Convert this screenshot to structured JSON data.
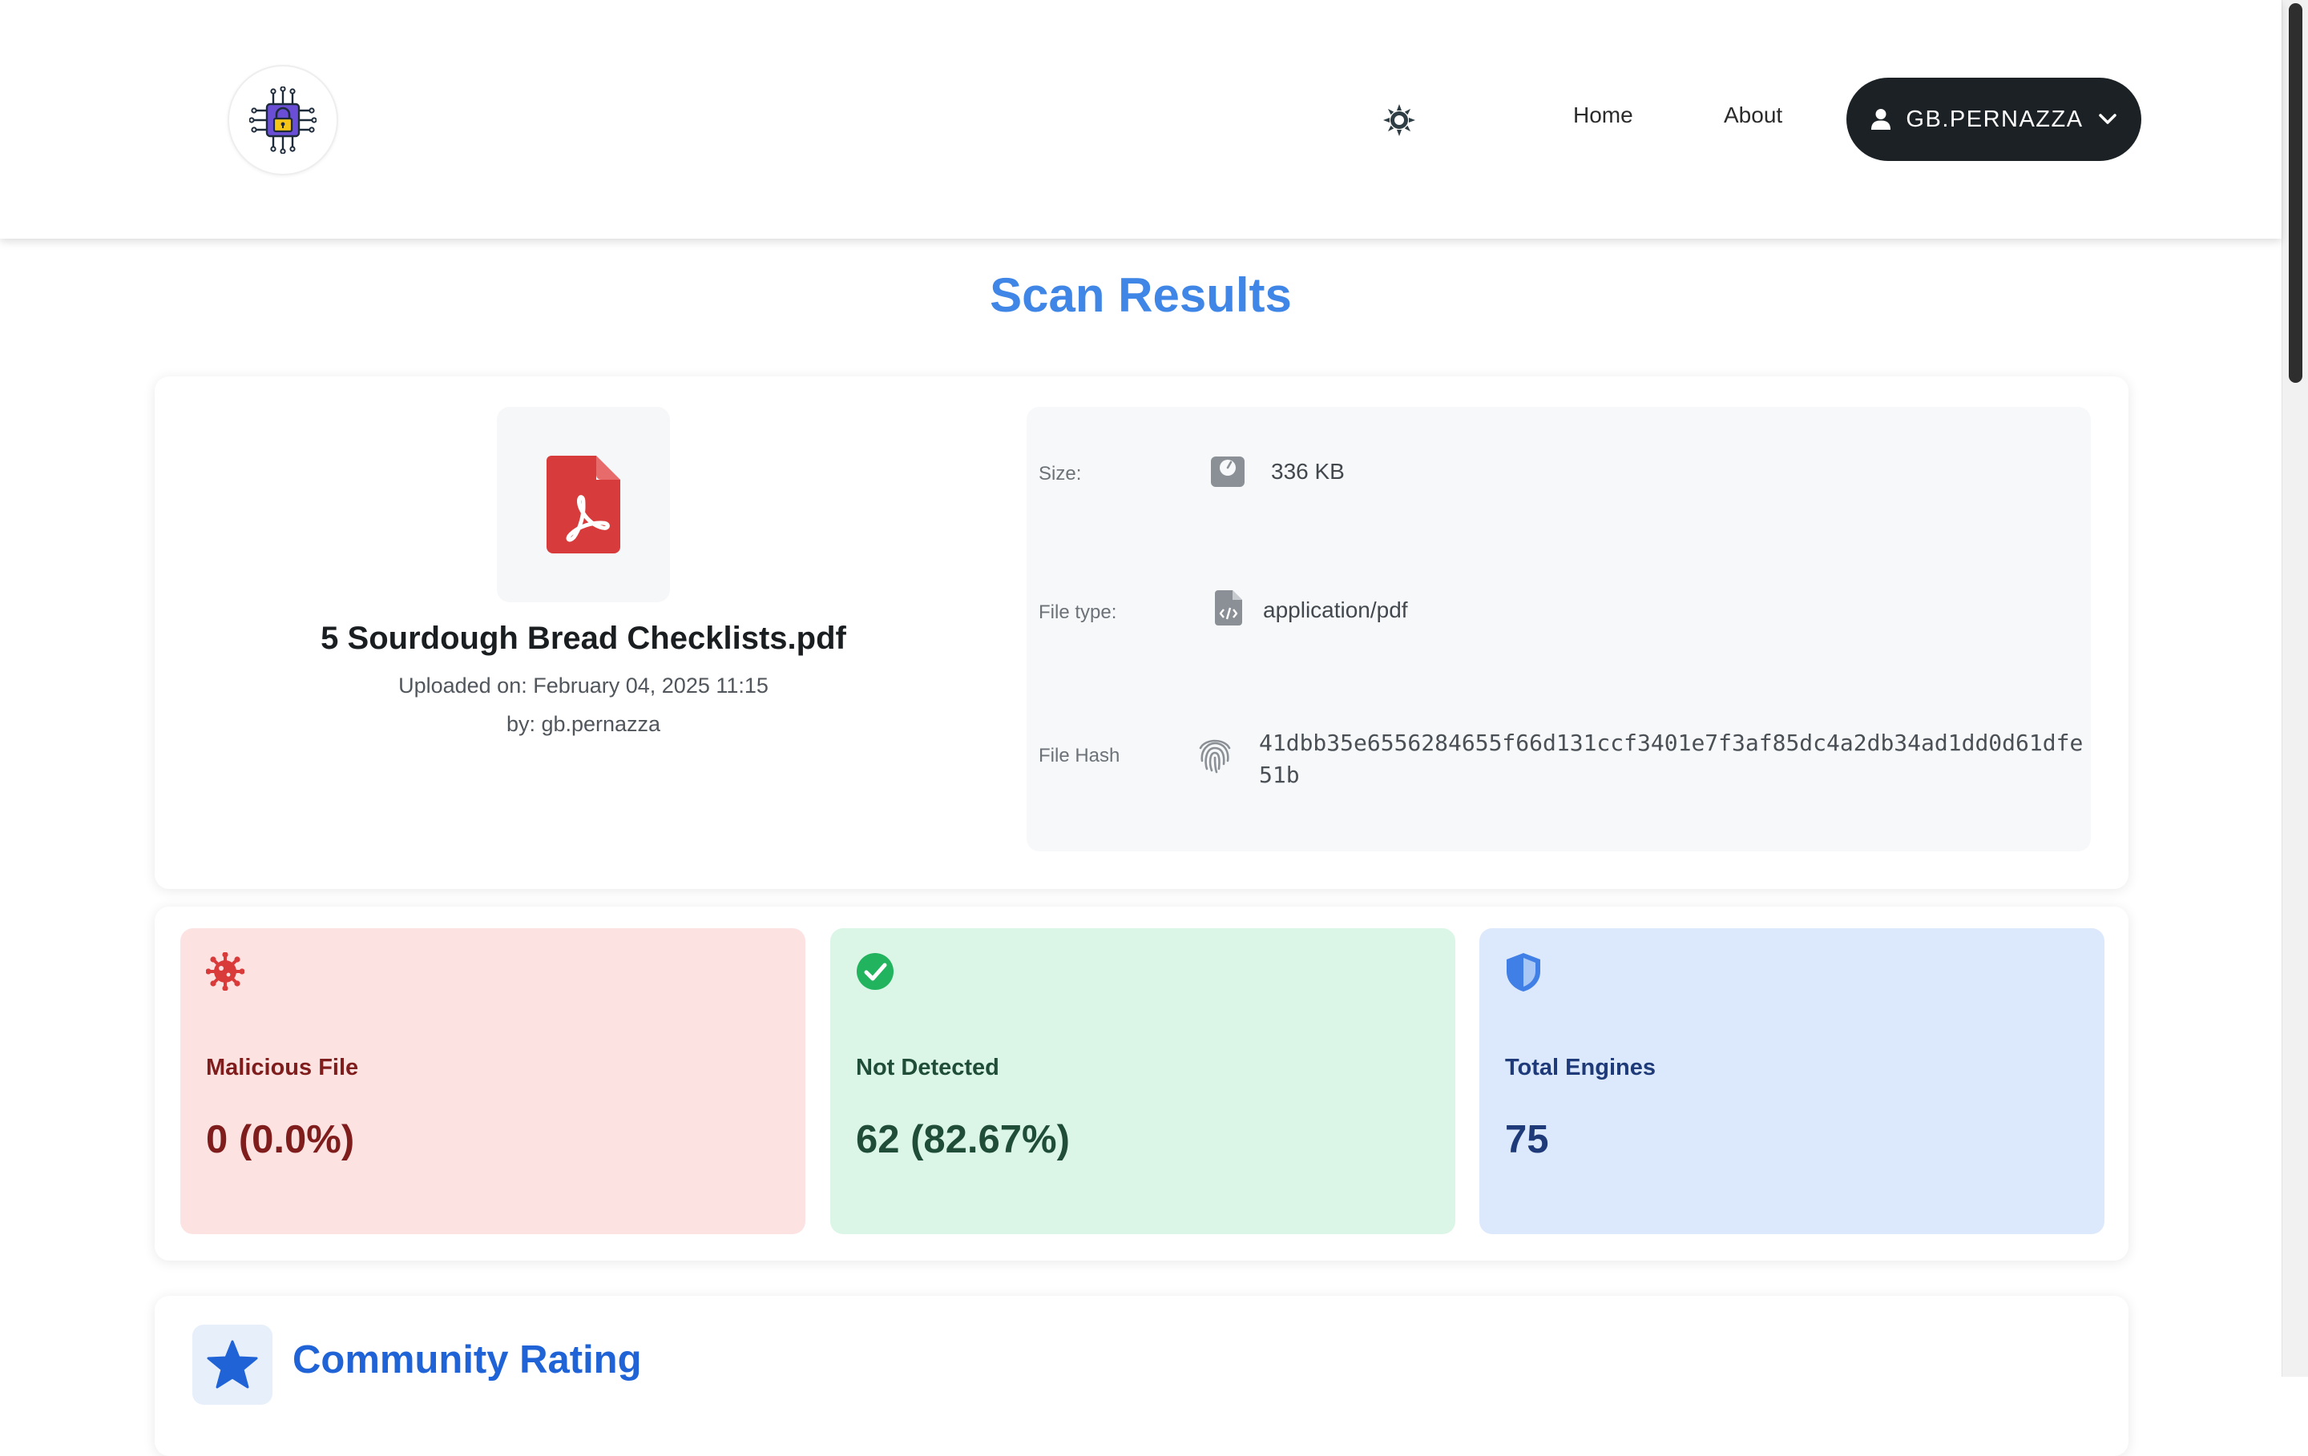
{
  "nav": {
    "links": [
      "Home",
      "About"
    ],
    "user_label": "GB.PERNAZZA"
  },
  "page": {
    "title": "Scan Results"
  },
  "file": {
    "name": "5 Sourdough Bread Checklists.pdf",
    "uploaded": "Uploaded on: February 04, 2025 11:15",
    "by": "by: gb.pernazza"
  },
  "details": {
    "size": {
      "label": "Size:",
      "value": "336 KB"
    },
    "type": {
      "label": "File type:",
      "value": "application/pdf"
    },
    "hash": {
      "label": "File Hash",
      "value": "41dbb35e6556284655f66d131ccf3401e7f3af85dc4a2db34ad1dd0d61dfe51b"
    }
  },
  "stats": [
    {
      "label": "Malicious File",
      "value": "0 (0.0%)",
      "icon": "virus-icon",
      "color": "#d93a3a"
    },
    {
      "label": "Not Detected",
      "value": "62 (82.67%)",
      "icon": "check-circle-icon",
      "color": "#22b35f"
    },
    {
      "label": "Total Engines",
      "value": "75",
      "icon": "shield-icon",
      "color": "#3f7fe6"
    }
  ],
  "rating": {
    "title": "Community Rating"
  },
  "colors": {
    "accent": "#3f86e6",
    "nav_button": "#1b2125"
  }
}
